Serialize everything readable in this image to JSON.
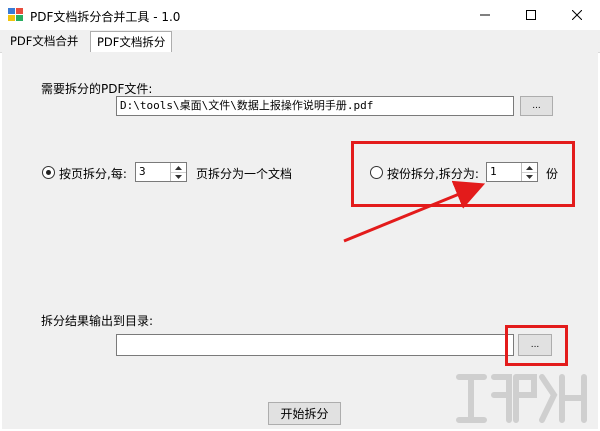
{
  "window": {
    "title": "PDF文档拆分合并工具 - 1.0",
    "controls": [
      "minimize-icon",
      "maximize-icon",
      "close-icon"
    ]
  },
  "tabs": [
    {
      "label": "PDF文档合并",
      "active": false
    },
    {
      "label": "PDF文档拆分",
      "active": true
    }
  ],
  "form": {
    "file_label": "需要拆分的PDF文件:",
    "file_path": "D:\\tools\\桌面\\文件\\数据上报操作说明手册.pdf",
    "browse_label": "...",
    "by_page": {
      "label": "按页拆分,每:",
      "value": "3",
      "suffix": "页拆分为一个文档",
      "checked": true
    },
    "by_count": {
      "label": "按份拆分,拆分为:",
      "value": "1",
      "suffix": "份",
      "checked": false
    },
    "output_label": "拆分结果输出到目录:",
    "output_path": "",
    "output_browse_label": "...",
    "start_label": "开始拆分"
  },
  "annotation": {
    "color": "#e31b1b"
  }
}
